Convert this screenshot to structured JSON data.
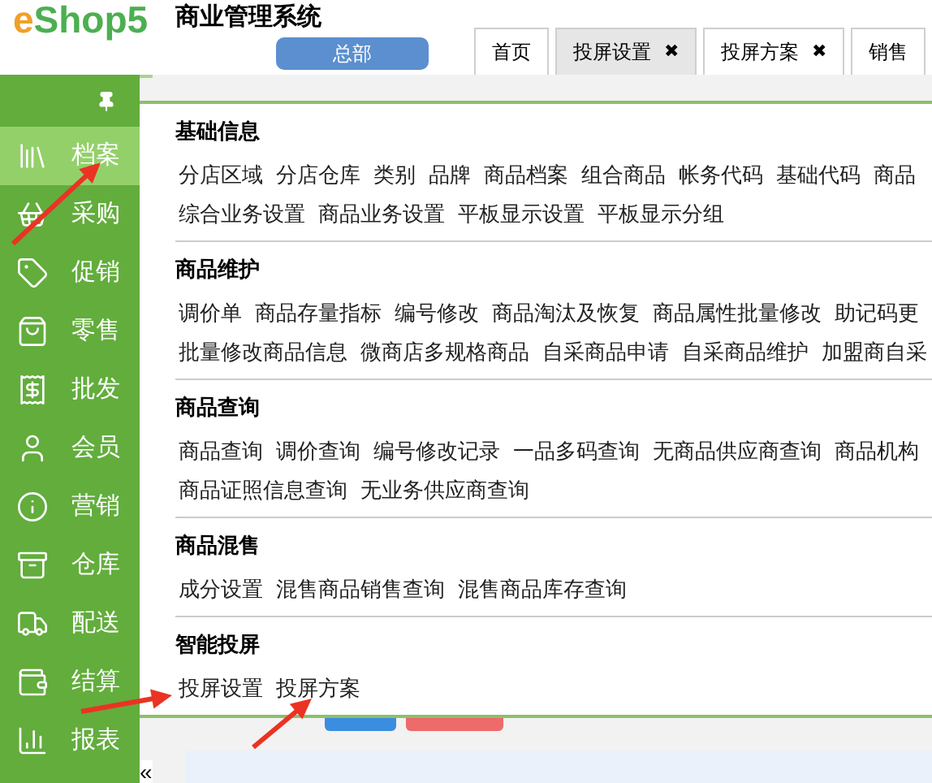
{
  "logo": {
    "e": "e",
    "rest": "Shop5"
  },
  "app_title": "商业管理系统",
  "branch_button": "总部",
  "tabs": [
    {
      "label": "首页",
      "selected": false,
      "closable": false
    },
    {
      "label": "投屏设置",
      "selected": true,
      "closable": true
    },
    {
      "label": "投屏方案",
      "selected": false,
      "closable": true
    },
    {
      "label": "销售",
      "selected": false,
      "closable": false
    }
  ],
  "close_glyph": "✖",
  "sidebar": {
    "items": [
      {
        "label": "档案",
        "selected": true
      },
      {
        "label": "采购",
        "selected": false
      },
      {
        "label": "促销",
        "selected": false
      },
      {
        "label": "零售",
        "selected": false
      },
      {
        "label": "批发",
        "selected": false
      },
      {
        "label": "会员",
        "selected": false
      },
      {
        "label": "营销",
        "selected": false
      },
      {
        "label": "仓库",
        "selected": false
      },
      {
        "label": "配送",
        "selected": false
      },
      {
        "label": "结算",
        "selected": false
      },
      {
        "label": "报表",
        "selected": false
      }
    ],
    "collapse": "«"
  },
  "menu": {
    "sections": [
      {
        "title": "基础信息",
        "links": [
          "分店区域",
          "分店仓库",
          "类别",
          "品牌",
          "商品档案",
          "组合商品",
          "帐务代码",
          "基础代码",
          "商品",
          "综合业务设置",
          "商品业务设置",
          "平板显示设置",
          "平板显示分组"
        ]
      },
      {
        "title": "商品维护",
        "links": [
          "调价单",
          "商品存量指标",
          "编号修改",
          "商品淘汰及恢复",
          "商品属性批量修改",
          "助记码更",
          "批量修改商品信息",
          "微商店多规格商品",
          "自采商品申请",
          "自采商品维护",
          "加盟商自采"
        ]
      },
      {
        "title": "商品查询",
        "links": [
          "商品查询",
          "调价查询",
          "编号修改记录",
          "一品多码查询",
          "无商品供应商查询",
          "商品机构",
          "商品证照信息查询",
          "无业务供应商查询"
        ]
      },
      {
        "title": "商品混售",
        "links": [
          "成分设置",
          "混售商品销售查询",
          "混售商品库存查询"
        ]
      },
      {
        "title": "智能投屏",
        "links": [
          "投屏设置",
          "投屏方案"
        ]
      }
    ]
  }
}
